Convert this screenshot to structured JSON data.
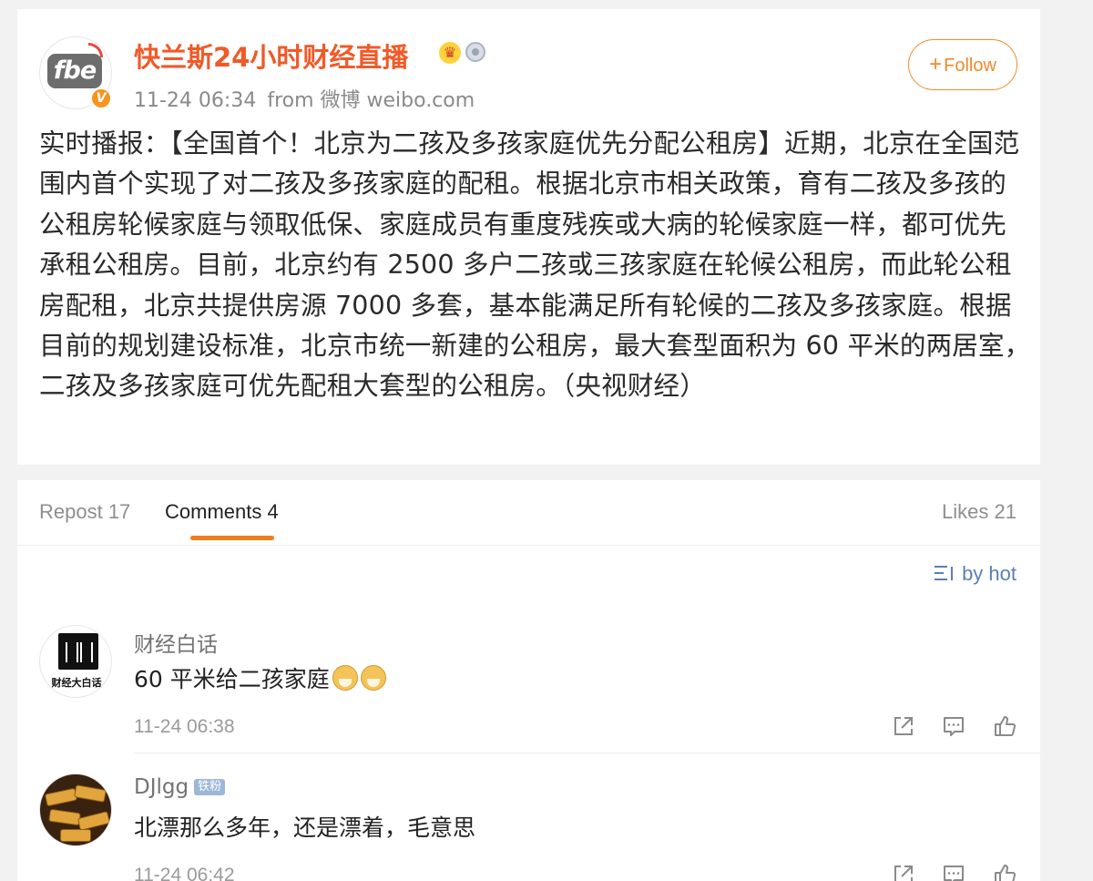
{
  "post": {
    "author_name": "快兰斯24小时财经直播",
    "avatar_logo_text": "fbe",
    "verified_mark": "V",
    "time": "11-24 06:34",
    "source": "from 微博 weibo.com",
    "follow_label": "Follow",
    "body": "实时播报：【全国首个！北京为二孩及多孩家庭优先分配公租房】近期，北京在全国范围内首个实现了对二孩及多孩家庭的配租。根据北京市相关政策，育有二孩及多孩的公租房轮候家庭与领取低保、家庭成员有重度残疾或大病的轮候家庭一样，都可优先承租公租房。目前，北京约有 2500 多户二孩或三孩家庭在轮候公租房，而此轮公租房配租，北京共提供房源 7000 多套，基本能满足所有轮候的二孩及多孩家庭。根据目前的规划建设标准，北京市统一新建的公租房，最大套型面积为 60 平米的两居室，二孩及多孩家庭可优先配租大套型的公租房。（央视财经）",
    "icons": [
      "crown-icon",
      "medal-icon",
      "plus-icon"
    ]
  },
  "tabs": {
    "repost": "Repost 17",
    "comments": "Comments 4",
    "likes": "Likes 21"
  },
  "sort": {
    "label": "by hot",
    "icon": "sort-icon"
  },
  "comments": [
    {
      "name": "财经白话",
      "avatar_caption": "财经大白话",
      "text": "60 平米给二孩家庭",
      "emoji": [
        "doge-icon",
        "doge-icon"
      ],
      "time": "11-24 06:38"
    },
    {
      "name": "DJlgg",
      "badge": "铁粉",
      "text": "北漂那么多年，还是漂着，毛意思",
      "time": "11-24 06:42"
    }
  ],
  "colors": {
    "author": "#f05a28",
    "follow": "#f08a2a",
    "tab_underline": "#f27c1c",
    "sort_link": "#5a7fb5",
    "background": "#f2f2f2"
  }
}
